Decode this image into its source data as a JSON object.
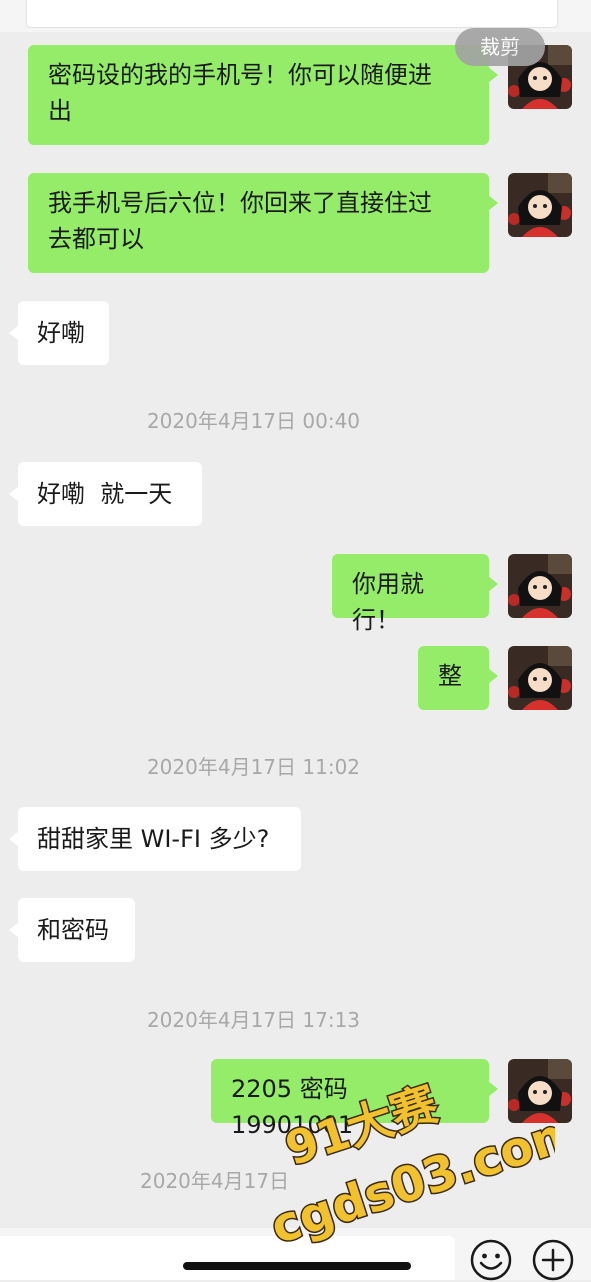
{
  "toolbar": {
    "crop_label": "裁剪"
  },
  "messages": {
    "m1": {
      "line1": "密码设的我的手机号！你可以随便进",
      "line2": "出"
    },
    "m2": {
      "line1": "我手机号后六位！你回来了直接住过",
      "line2": "去都可以"
    },
    "m3": "好嘞",
    "ts1": "2020年4月17日 00:40",
    "m4": "好嘞  就一天",
    "m5": "你用就行！",
    "m6": "整",
    "ts2": "2020年4月17日 11:02",
    "m7": "甜甜家里 WI-FI 多少?",
    "m8": "和密码",
    "ts3": "2020年4月17日 17:13",
    "m9": "2205 密码 19901001",
    "ts4": "2020年4月17日"
  },
  "watermark": {
    "line1": "91大赛",
    "line2": "cgds03.com"
  },
  "input_bar": {
    "emoji_icon": "emoji-icon",
    "plus_icon": "plus-icon"
  },
  "colors": {
    "my_bubble": "#95ec69",
    "their_bubble": "#ffffff",
    "background": "#ededed",
    "watermark_fill": "#f2c12e"
  }
}
